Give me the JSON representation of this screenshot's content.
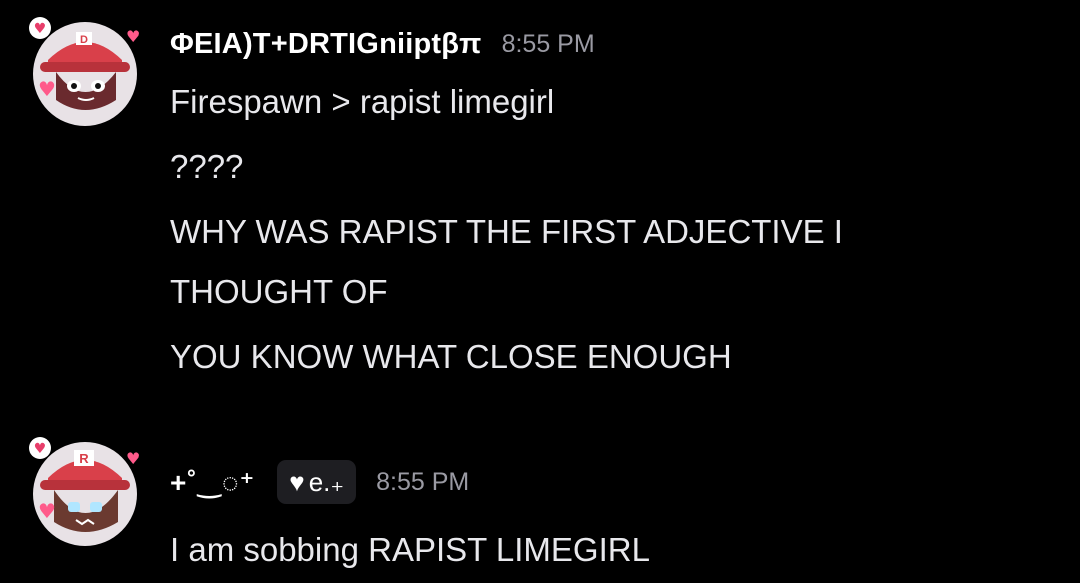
{
  "messages": [
    {
      "author": "ΦEIA)T+DRTIGniiptβπ",
      "timestamp": "8:55 PM",
      "lines": [
        "Firespawn > rapist limegirl",
        "????",
        "WHY WAS RAPIST THE FIRST ADJECTIVE I",
        "THOUGHT OF",
        "YOU KNOW WHAT CLOSE ENOUGH"
      ]
    },
    {
      "author": "+˚‿◌⁺",
      "server_tag": "e.₊",
      "timestamp": "8:55 PM",
      "lines": [
        "I am sobbing RAPIST LIMEGIRL"
      ]
    }
  ],
  "avatars": [
    {
      "hat_letter": "D",
      "hat_color": "#e0474c",
      "accent": "#ff5a8a"
    },
    {
      "hat_letter": "R",
      "hat_color": "#e0474c",
      "accent": "#ff5a8a"
    }
  ]
}
